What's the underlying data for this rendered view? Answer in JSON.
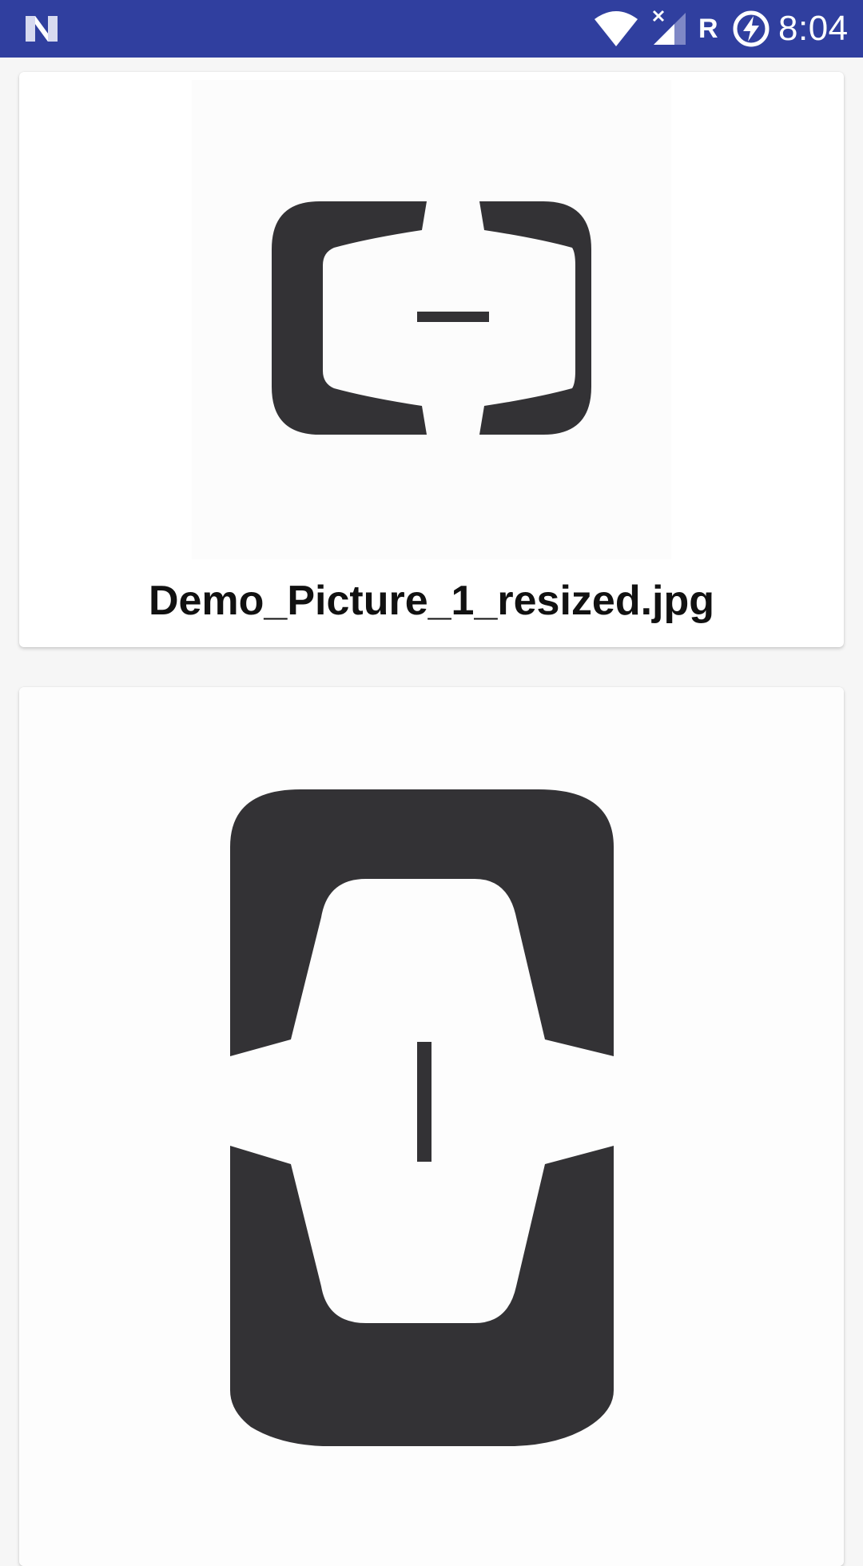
{
  "status_bar": {
    "time": "8:04",
    "roaming_indicator": "R",
    "icons": [
      "n-logo-icon",
      "wifi-icon",
      "cell-signal-no-data-icon",
      "battery-charging-icon"
    ],
    "background_color": "#303f9f"
  },
  "gallery": {
    "items": [
      {
        "caption": "Demo_Picture_1_resized.jpg",
        "image": "aliyun-logo-horizontal"
      },
      {
        "caption": "",
        "image": "aliyun-logo-vertical"
      }
    ]
  },
  "colors": {
    "logo": "#333235",
    "page_background": "#f6f6f6"
  }
}
